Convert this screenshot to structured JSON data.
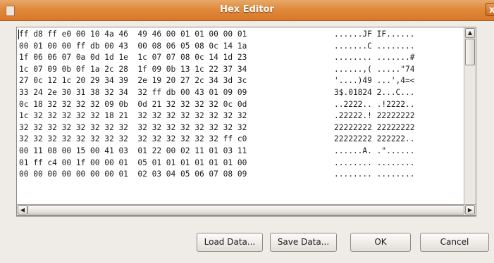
{
  "window": {
    "title": "Hex Editor",
    "close_label": "x"
  },
  "hex_view": {
    "rows": [
      {
        "hex": "ff d8 ff e0 00 10 4a 46  49 46 00 01 01 00 00 01",
        "ascii": "......JF IF......"
      },
      {
        "hex": "00 01 00 00 ff db 00 43  00 08 06 05 08 0c 14 1a",
        "ascii": ".......C ........"
      },
      {
        "hex": "1f 06 06 07 0a 0d 1d 1e  1c 07 07 08 0c 14 1d 23",
        "ascii": "........ .......#"
      },
      {
        "hex": "1c 07 09 0b 0f 1a 2c 28  1f 09 0b 13 1c 22 37 34",
        "ascii": "......,( .....\"74"
      },
      {
        "hex": "27 0c 12 1c 20 29 34 39  2e 19 20 27 2c 34 3d 3c",
        "ascii": "'....)49 ...',4=<"
      },
      {
        "hex": "33 24 2e 30 31 38 32 34  32 ff db 00 43 01 09 09",
        "ascii": "3$.01824 2...C..."
      },
      {
        "hex": "0c 18 32 32 32 32 09 0b  0d 21 32 32 32 32 0c 0d",
        "ascii": "..2222.. .!2222.."
      },
      {
        "hex": "1c 32 32 32 32 32 18 21  32 32 32 32 32 32 32 32",
        "ascii": ".22222.! 22222222"
      },
      {
        "hex": "32 32 32 32 32 32 32 32  32 32 32 32 32 32 32 32",
        "ascii": "22222222 22222222"
      },
      {
        "hex": "32 32 32 32 32 32 32 32  32 32 32 32 32 32 ff c0",
        "ascii": "22222222 222222.."
      },
      {
        "hex": "00 11 08 00 15 00 41 03  01 22 00 02 11 01 03 11",
        "ascii": "......A. .\"......"
      },
      {
        "hex": "01 ff c4 00 1f 00 00 01  05 01 01 01 01 01 01 00",
        "ascii": "........ ........"
      },
      {
        "hex": "00 00 00 00 00 00 00 01  02 03 04 05 06 07 08 09",
        "ascii": "........ ........"
      }
    ]
  },
  "buttons": {
    "load": "Load Data...",
    "save": "Save Data...",
    "ok": "OK",
    "cancel": "Cancel"
  }
}
